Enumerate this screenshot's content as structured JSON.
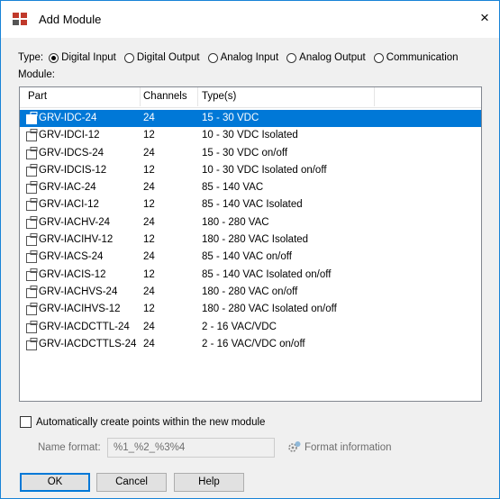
{
  "window": {
    "title": "Add Module",
    "close": "×"
  },
  "type_row": {
    "label": "Type:",
    "options": [
      {
        "label": "Digital Input",
        "selected": true
      },
      {
        "label": "Digital Output",
        "selected": false
      },
      {
        "label": "Analog Input",
        "selected": false
      },
      {
        "label": "Analog Output",
        "selected": false
      },
      {
        "label": "Communication",
        "selected": false
      }
    ]
  },
  "module_label": "Module:",
  "list": {
    "columns": [
      "Part",
      "Channels",
      "Type(s)"
    ],
    "rows": [
      {
        "part": "GRV-IDC-24",
        "channels": "24",
        "types": "15 - 30 VDC",
        "selected": true
      },
      {
        "part": "GRV-IDCI-12",
        "channels": "12",
        "types": "10 - 30 VDC Isolated"
      },
      {
        "part": "GRV-IDCS-24",
        "channels": "24",
        "types": "15 - 30 VDC on/off"
      },
      {
        "part": "GRV-IDCIS-12",
        "channels": "12",
        "types": "10 - 30 VDC Isolated on/off"
      },
      {
        "part": "GRV-IAC-24",
        "channels": "24",
        "types": "85 - 140 VAC"
      },
      {
        "part": "GRV-IACI-12",
        "channels": "12",
        "types": "85 - 140 VAC Isolated"
      },
      {
        "part": "GRV-IACHV-24",
        "channels": "24",
        "types": "180 - 280 VAC"
      },
      {
        "part": "GRV-IACIHV-12",
        "channels": "12",
        "types": "180 - 280 VAC Isolated"
      },
      {
        "part": "GRV-IACS-24",
        "channels": "24",
        "types": "85 - 140 VAC on/off"
      },
      {
        "part": "GRV-IACIS-12",
        "channels": "12",
        "types": "85 - 140 VAC Isolated on/off"
      },
      {
        "part": "GRV-IACHVS-24",
        "channels": "24",
        "types": "180 - 280 VAC on/off"
      },
      {
        "part": "GRV-IACIHVS-12",
        "channels": "12",
        "types": "180 - 280 VAC Isolated on/off"
      },
      {
        "part": "GRV-IACDCTTL-24",
        "channels": "24",
        "types": "2 - 16 VAC/VDC"
      },
      {
        "part": "GRV-IACDCTTLS-24",
        "channels": "24",
        "types": "2 - 16 VAC/VDC on/off"
      }
    ]
  },
  "auto_create": {
    "label": "Automatically create points within the new module",
    "checked": false
  },
  "name_format": {
    "label": "Name format:",
    "value": "%1_%2_%3%4"
  },
  "format_info": "Format information",
  "buttons": {
    "ok": "OK",
    "cancel": "Cancel",
    "help": "Help"
  },
  "colors": {
    "selection": "#0078d7",
    "dialog_bg": "#f0f0f0",
    "border": "#1883d7"
  },
  "icons": {
    "app": "module-icon",
    "row": "module-row-icon",
    "format": "gear-info-icon"
  }
}
